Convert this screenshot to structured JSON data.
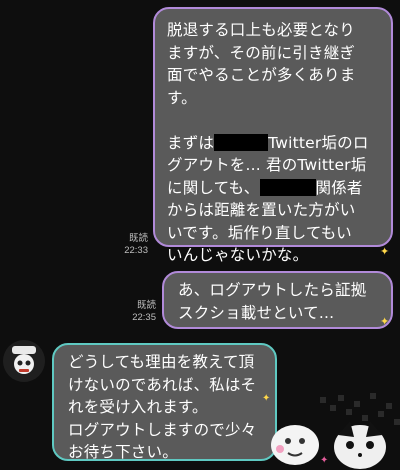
{
  "messages": {
    "m1": {
      "line1": "脱退する口上も必要となり",
      "line2": "ますが、その前に引き継ぎ",
      "line3": "面でやることが多くありま",
      "line4": "す。",
      "line5_start": "まずは",
      "line5_end": "Twitter垢のロ",
      "line6": "グアウトを... 君のTwitter垢",
      "line7": "に関しても、",
      "line7_end": "関係者",
      "line8": "からは距離を置いた方がい",
      "line9": "いです。垢作り直してもい",
      "line10": "いんじゃないかな。",
      "read": "既読",
      "time": "22:33"
    },
    "m2": {
      "line1": "あ、ログアウトしたら証拠",
      "line2": "スクショ載せといて...",
      "read": "既読",
      "time": "22:35"
    },
    "m3": {
      "line1": "どうしても理由を教えて頂",
      "line2": "けないのであれば、私はそ",
      "line3": "れを受け入れます。",
      "line4": "ログアウトしますので少々",
      "line5": "お待ち下さい。"
    }
  },
  "icons": [
    "avatar-icon",
    "sparkle-icon",
    "sticker-decoration"
  ],
  "colors": {
    "bubble": "#5a5a5a",
    "outgoing_border": "#b18ad9",
    "incoming_border": "#5fc9c2",
    "background": "#0e0e0e"
  }
}
